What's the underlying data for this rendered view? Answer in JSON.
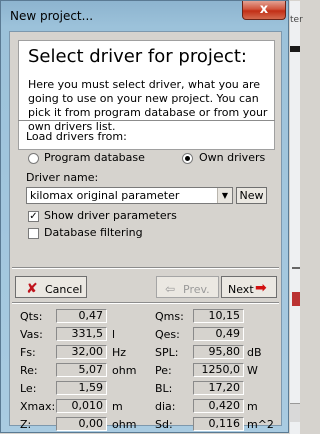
{
  "window": {
    "title": "New project...",
    "close": "x"
  },
  "side": {
    "label": "ter"
  },
  "header": {
    "heading": "Select driver for project:",
    "description": "Here you must select driver, what you are going to use on your new project. You can pick it from program database or from your own drivers list."
  },
  "load": {
    "label": "Load drivers from:",
    "options": [
      {
        "label": "Program database",
        "selected": false
      },
      {
        "label": "Own drivers",
        "selected": true
      }
    ]
  },
  "driver": {
    "label": "Driver name:",
    "value": "kilomax original parameter",
    "new_label": "New"
  },
  "checks": [
    {
      "label": "Show driver parameters",
      "checked": true
    },
    {
      "label": "Database filtering",
      "checked": false
    }
  ],
  "nav": {
    "cancel": "Cancel",
    "prev": "Prev.",
    "next": "Next"
  },
  "params_left": [
    {
      "name": "Qts:",
      "value": "0,47",
      "unit": ""
    },
    {
      "name": "Vas:",
      "value": "331,5",
      "unit": "l"
    },
    {
      "name": "Fs:",
      "value": "32,00",
      "unit": "Hz"
    },
    {
      "name": "Re:",
      "value": "5,07",
      "unit": "ohm"
    },
    {
      "name": "Le:",
      "value": "1,59",
      "unit": ""
    },
    {
      "name": "Xmax:",
      "value": "0,010",
      "unit": "m"
    },
    {
      "name": "Z:",
      "value": "0,00",
      "unit": "ohm"
    }
  ],
  "params_right": [
    {
      "name": "Qms:",
      "value": "10,15",
      "unit": ""
    },
    {
      "name": "Qes:",
      "value": "0,49",
      "unit": ""
    },
    {
      "name": "SPL:",
      "value": "95,80",
      "unit": "dB"
    },
    {
      "name": "Pe:",
      "value": "1250,0",
      "unit": "W"
    },
    {
      "name": "BL:",
      "value": "17,20",
      "unit": ""
    },
    {
      "name": "dia:",
      "value": "0,420",
      "unit": "m"
    },
    {
      "name": "Sd:",
      "value": "0,116",
      "unit": "m^2"
    }
  ],
  "colors": {
    "cancel_x": "#c0141c",
    "next_arrow": "#d21010",
    "prev_disabled": "#9a9a9a"
  }
}
